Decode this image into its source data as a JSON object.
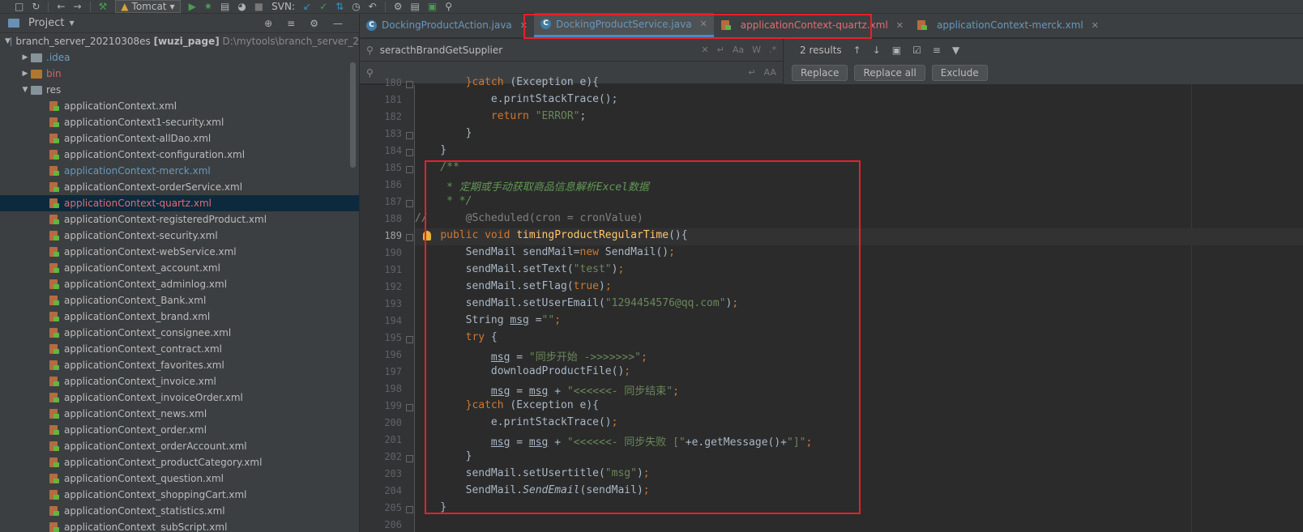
{
  "toolbar": {
    "run_config": "Tomcat",
    "svn_label": "SVN:"
  },
  "project": {
    "title": "Project",
    "root": {
      "name": "branch_server_20210308es",
      "module": "[wuzi_page]",
      "path": "D:\\mytools\\branch_server_2"
    },
    "folders": [
      ".idea",
      "bin",
      "res"
    ],
    "files": [
      "applicationContext.xml",
      "applicationContext1-security.xml",
      "applicationContext-allDao.xml",
      "applicationContext-configuration.xml",
      "applicationContext-merck.xml",
      "applicationContext-orderService.xml",
      "applicationContext-quartz.xml",
      "applicationContext-registeredProduct.xml",
      "applicationContext-security.xml",
      "applicationContext-webService.xml",
      "applicationContext_account.xml",
      "applicationContext_adminlog.xml",
      "applicationContext_Bank.xml",
      "applicationContext_brand.xml",
      "applicationContext_consignee.xml",
      "applicationContext_contract.xml",
      "applicationContext_favorites.xml",
      "applicationContext_invoice.xml",
      "applicationContext_invoiceOrder.xml",
      "applicationContext_news.xml",
      "applicationContext_order.xml",
      "applicationContext_orderAccount.xml",
      "applicationContext_productCategory.xml",
      "applicationContext_question.xml",
      "applicationContext_shoppingCart.xml",
      "applicationContext_statistics.xml",
      "applicationContext_subScript.xml"
    ]
  },
  "tabs": [
    {
      "label": "DockingProductAction.java"
    },
    {
      "label": "DockingProductService.java"
    },
    {
      "label": "applicationContext-quartz.xml"
    },
    {
      "label": "applicationContext-merck.xml"
    }
  ],
  "find": {
    "query": "seracthBrandGetSupplier",
    "results": "2 results",
    "replace_label": "Replace",
    "replace_all_label": "Replace all",
    "exclude_label": "Exclude"
  },
  "editor": {
    "line_numbers": [
      "180",
      "181",
      "182",
      "183",
      "184",
      "185",
      "186",
      "187",
      "188",
      "189",
      "190",
      "191",
      "192",
      "193",
      "194",
      "195",
      "196",
      "197",
      "198",
      "199",
      "200",
      "201",
      "202",
      "203",
      "204",
      "205",
      "206"
    ]
  },
  "colors": {
    "highlight_box": "#e8202a",
    "keyword": "#cc7832",
    "string": "#6a8759",
    "doc_comment": "#629755"
  }
}
